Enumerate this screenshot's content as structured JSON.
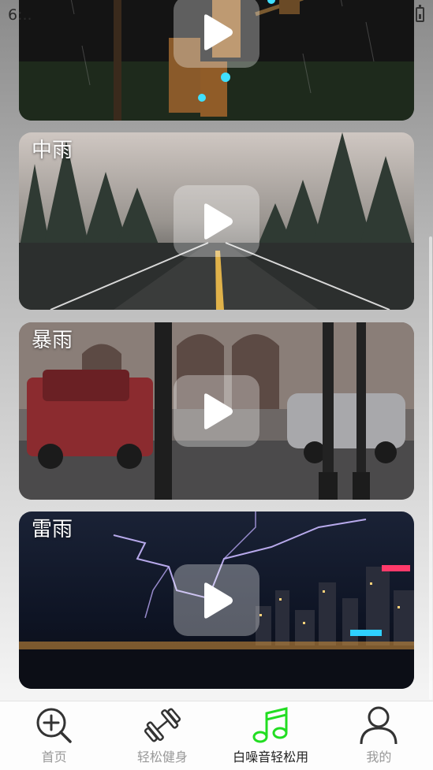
{
  "status_bar": {
    "time": "6:..",
    "battery_icon": "battery-charging-icon"
  },
  "cards": [
    {
      "title": "",
      "scene": "rain-traffic-light",
      "play_icon": "play-icon"
    },
    {
      "title": "中雨",
      "scene": "rain-road-forest",
      "play_icon": "play-icon"
    },
    {
      "title": "暴雨",
      "scene": "heavy-rain-street",
      "play_icon": "play-icon"
    },
    {
      "title": "雷雨",
      "scene": "thunderstorm-city",
      "play_icon": "play-icon"
    }
  ],
  "tabs": [
    {
      "label": "首页",
      "icon": "zoom-in-icon",
      "active": false
    },
    {
      "label": "轻松健身",
      "icon": "dumbbell-icon",
      "active": false
    },
    {
      "label": "白噪音轻松用",
      "icon": "music-note-icon",
      "active": true
    },
    {
      "label": "我的",
      "icon": "person-icon",
      "active": false
    }
  ],
  "colors": {
    "active_tab_icon": "#22dd22",
    "inactive_tab_icon": "#333333",
    "inactive_tab_label": "#999999",
    "active_tab_label": "#222222"
  }
}
